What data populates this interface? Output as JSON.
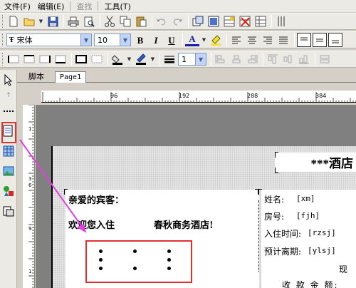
{
  "menubar": {
    "items": [
      {
        "label": "文件(F)",
        "enabled": true
      },
      {
        "label": "编辑(E)",
        "enabled": true
      },
      {
        "label": "查找",
        "enabled": false
      },
      {
        "label": "工具(T)",
        "enabled": true
      }
    ]
  },
  "format_toolbar": {
    "font_name": "宋体",
    "font_size": "10",
    "bold_label": "B",
    "italic_label": "I",
    "underline_label": "U",
    "font_color_label": "A"
  },
  "border_toolbar": {
    "line_width": "1"
  },
  "tabs": [
    {
      "label": "脚本",
      "active": false
    },
    {
      "label": "Page1",
      "active": true
    }
  ],
  "ruler": {
    "h_ticks": [
      "96",
      "192",
      "288",
      "384"
    ],
    "v_ticks": [
      "1",
      "3",
      "6",
      "9",
      "1",
      "2",
      "1",
      "5"
    ]
  },
  "report": {
    "title": "***酒店",
    "greeting": "亲爱的宾客：",
    "welcome": "欢迎您入住",
    "hotel_name": "春秋商务酒店!",
    "fields": [
      {
        "label": "姓名:",
        "value": "[xm]"
      },
      {
        "label": "房号:",
        "value": "[fjh]"
      },
      {
        "label": "入住时间:",
        "value": "[rzsj]"
      },
      {
        "label": "预计离期:",
        "value": "[ylsj]"
      }
    ],
    "partial_label": "现",
    "footer_label": "收 款 金 额:"
  },
  "colors": {
    "highlight": "#e53030",
    "arrow": "#e040e0",
    "background": "#d4d0c8"
  }
}
